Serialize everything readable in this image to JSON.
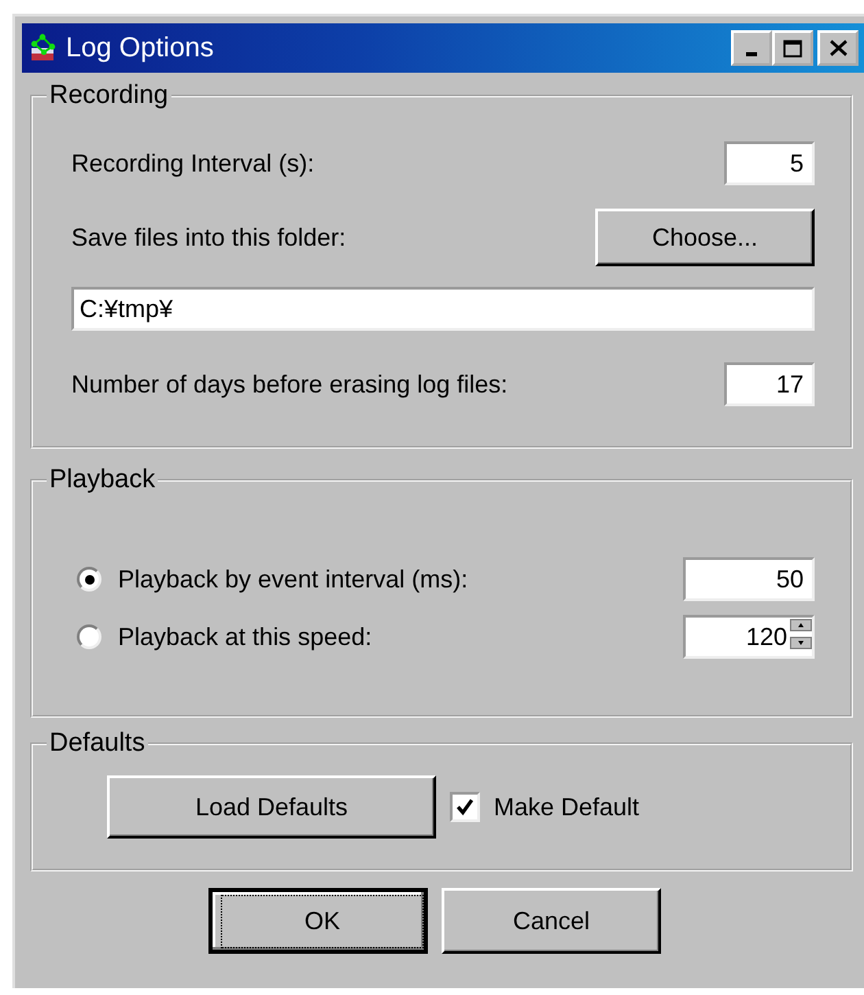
{
  "window": {
    "title": "Log Options"
  },
  "recording": {
    "title": "Recording",
    "interval_label": "Recording Interval (s):",
    "interval_value": "5",
    "folder_label": "Save files into this folder:",
    "choose_button": "Choose...",
    "folder_path": "C:¥tmp¥",
    "days_label": "Number of days before erasing log files:",
    "days_value": "17"
  },
  "playback": {
    "title": "Playback",
    "options": [
      {
        "kind": "textbox",
        "label": "Playback by event interval (ms):",
        "selected": true,
        "value": "50"
      },
      {
        "kind": "spinner",
        "label": "Playback at this speed:",
        "selected": false,
        "value": "120"
      }
    ]
  },
  "defaults": {
    "title": "Defaults",
    "load_button": "Load Defaults",
    "make_default": {
      "label": "Make Default",
      "checked": true
    }
  },
  "buttons": [
    {
      "label": "OK",
      "focused": true
    },
    {
      "label": "Cancel",
      "focused": false
    }
  ]
}
